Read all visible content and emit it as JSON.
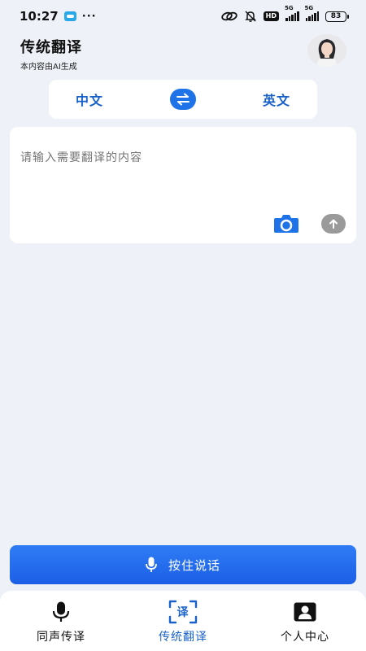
{
  "status_bar": {
    "time": "10:27",
    "dots": "···",
    "hd": "HD",
    "sig1_label": "5G",
    "sig2_label": "5G",
    "battery": "83"
  },
  "header": {
    "title": "传统翻译",
    "subtitle": "本内容由AI生成"
  },
  "lang": {
    "source": "中文",
    "target": "英文"
  },
  "input": {
    "placeholder": "请输入需要翻译的内容",
    "value": ""
  },
  "talk_button": {
    "label": "按住说话"
  },
  "nav": {
    "items": [
      {
        "label": "同声传译"
      },
      {
        "label": "传统翻译"
      },
      {
        "label": "个人中心"
      }
    ],
    "translate_icon_char": "译"
  },
  "colors": {
    "accent": "#1e73e8",
    "accent_text": "#1a62c9",
    "background": "#eef2f8"
  }
}
